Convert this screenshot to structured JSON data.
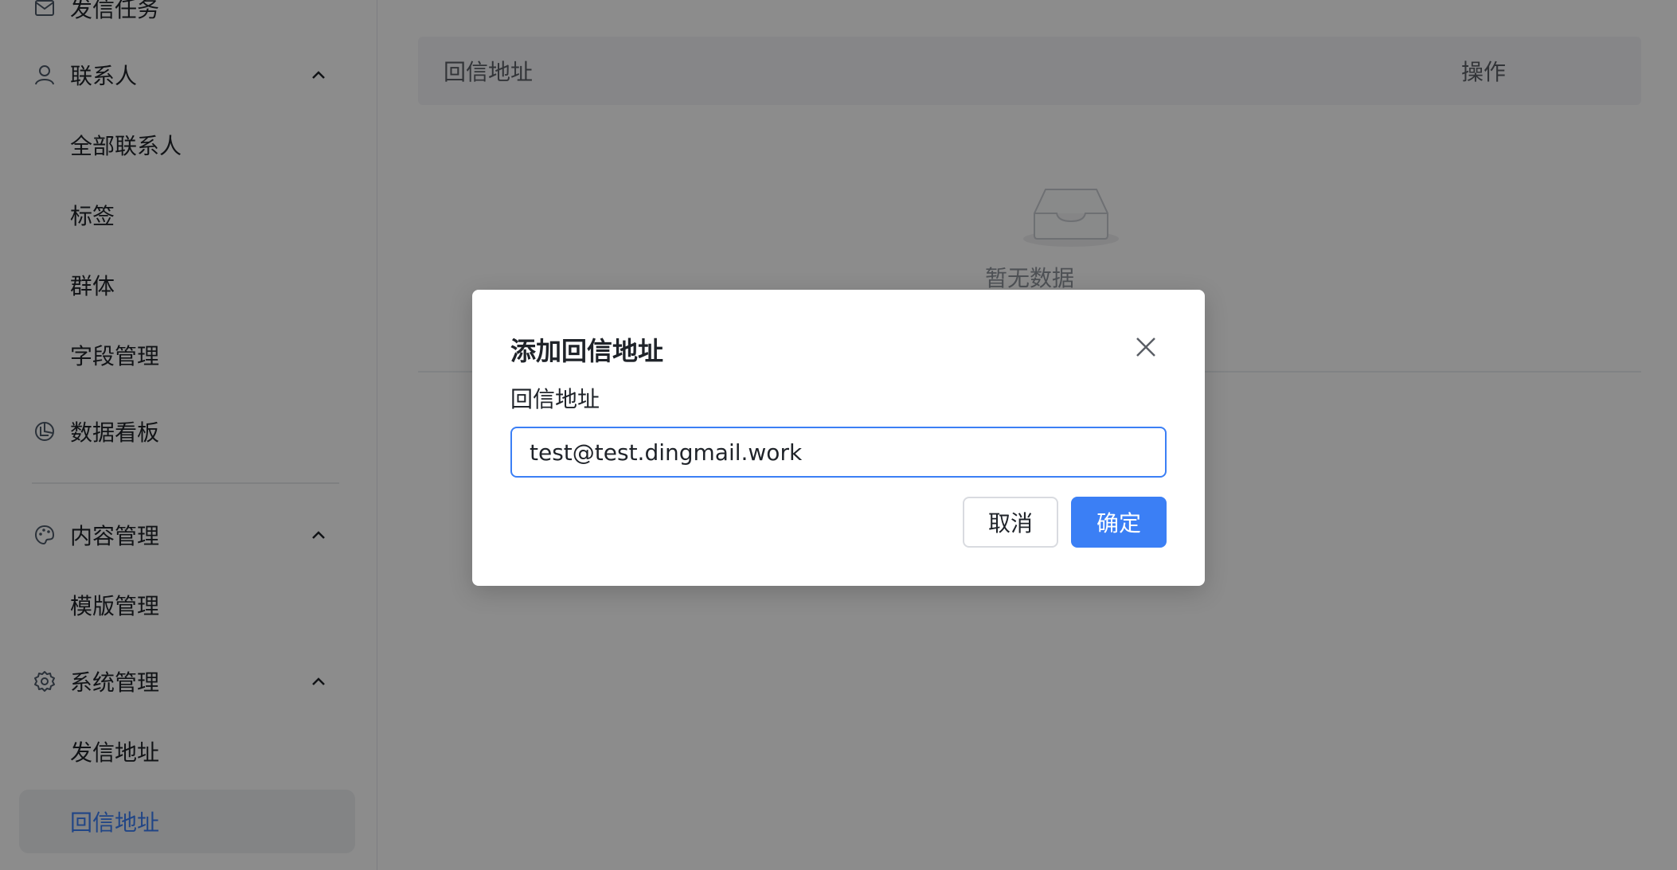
{
  "sidebar": {
    "top_item": {
      "label": "发信任务",
      "icon": "mail-icon"
    },
    "contacts": {
      "label": "联系人",
      "icon": "user-icon",
      "children": [
        "全部联系人",
        "标签",
        "群体",
        "字段管理"
      ]
    },
    "dashboard": {
      "label": "数据看板",
      "icon": "pie-chart-icon"
    },
    "content": {
      "label": "内容管理",
      "icon": "palette-icon",
      "children": [
        "模版管理"
      ]
    },
    "system": {
      "label": "系统管理",
      "icon": "gear-icon",
      "children": [
        "发信地址",
        "回信地址"
      ],
      "active_child": "回信地址"
    }
  },
  "table": {
    "columns": [
      "回信地址",
      "操作"
    ],
    "empty_text": "暂无数据"
  },
  "modal": {
    "title": "添加回信地址",
    "field_label": "回信地址",
    "field_value": "test@test.dingmail.work",
    "cancel_label": "取消",
    "ok_label": "确定"
  },
  "colors": {
    "accent": "#3b7ff5",
    "overlay": "rgba(0,0,0,0.45)",
    "active_bg": "#eef0f3"
  }
}
